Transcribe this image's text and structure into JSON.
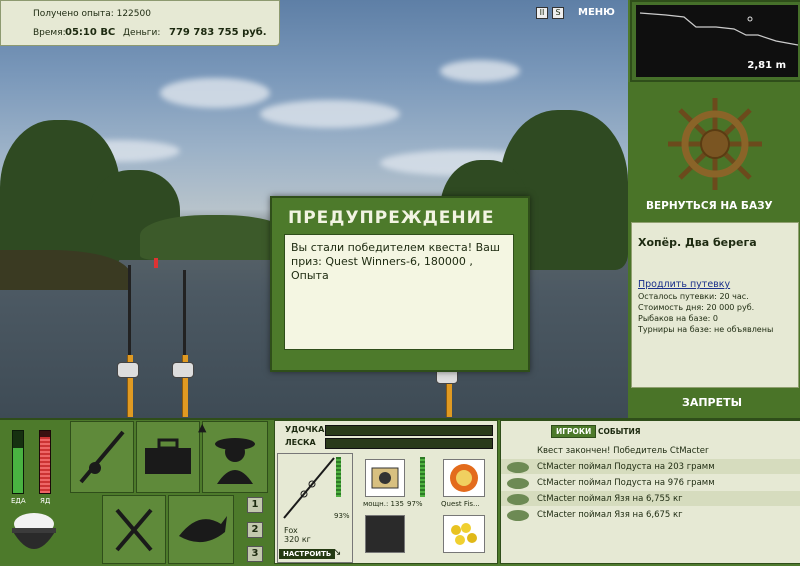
{
  "info": {
    "experience_label": "Получено опыта: 122500",
    "time_label": "Время:",
    "time_value": "05:10 ВС",
    "money_label": "Деньги:",
    "money_value": "779 783 755 руб."
  },
  "top_menu": {
    "pause_icon": "II",
    "sound_icon": "S",
    "menu_label": "МЕНЮ"
  },
  "depth": {
    "value": "2,81 m"
  },
  "side": {
    "return_label": "ВЕРНУТЬСЯ НА БАЗУ",
    "base_name": "Хопёр. Два берега",
    "extend_link": "Продлить путевку",
    "time_left": "Осталось путевки: 20 час.",
    "cost_day": "Стоимость дня: 20 000 руб.",
    "fishers": "Рыбаков на базе: 0",
    "tournaments": "Турниры на базе: не объявлены",
    "bans_label": "ЗАПРЕТЫ"
  },
  "dialog": {
    "title": "ПРЕДУПРЕЖДЕНИЕ",
    "message": "Вы стали победителем квеста! Ваш приз: Quest Winners-6, 180000 , Опыта"
  },
  "bottom": {
    "eat_label": "ЕДА",
    "poison_label": "ЯД",
    "eat_level": 0.72,
    "poison_level": 0.9,
    "tab1": "1",
    "tab2": "2",
    "tab3": "3"
  },
  "tackle": {
    "rod_label": "УДОЧКА",
    "line_label": "ЛЕСКА",
    "rod_name": "Fox",
    "rod_weight": "320 кг",
    "rod_pct": "93%",
    "reel_power": "мощн.: 135",
    "reel_pct": "97%",
    "lure_name": "Quest Fis...",
    "setup_button": "НАСТРОИТЬ"
  },
  "events": {
    "tab_players": "ИГРОКИ",
    "tab_events": "СОБЫТИЯ",
    "rows": [
      "Квест закончен! Победитель CtMacter",
      "CtMacter поймал Подуста на 203 грамм",
      "CtMacter поймал Подуста на 976 грамм",
      "CtMacter поймал Язя на 6,755 кг",
      "CtMacter поймал Язя на 6,675 кг"
    ]
  }
}
